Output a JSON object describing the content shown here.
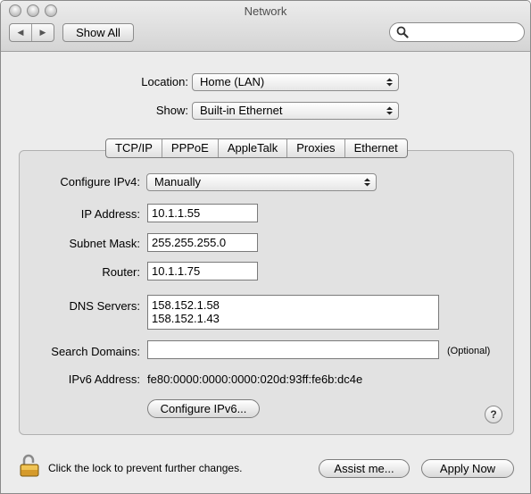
{
  "window": {
    "title": "Network"
  },
  "toolbar": {
    "back_glyph": "◀",
    "forward_glyph": "▶",
    "show_all_label": "Show All",
    "search_placeholder": ""
  },
  "location": {
    "label": "Location:",
    "value": "Home (LAN)"
  },
  "show": {
    "label": "Show:",
    "value": "Built-in Ethernet"
  },
  "tabs": [
    {
      "label": "TCP/IP",
      "selected": true
    },
    {
      "label": "PPPoE",
      "selected": false
    },
    {
      "label": "AppleTalk",
      "selected": false
    },
    {
      "label": "Proxies",
      "selected": false
    },
    {
      "label": "Ethernet",
      "selected": false
    }
  ],
  "tcpip": {
    "configure_label": "Configure IPv4:",
    "configure_value": "Manually",
    "ip_label": "IP Address:",
    "ip_value": "10.1.1.55",
    "subnet_label": "Subnet Mask:",
    "subnet_value": "255.255.255.0",
    "router_label": "Router:",
    "router_value": "10.1.1.75",
    "dns_label": "DNS Servers:",
    "dns_values": [
      "158.152.1.58",
      "158.152.1.43"
    ],
    "search_domains_label": "Search Domains:",
    "search_domains_value": "",
    "optional_label": "(Optional)",
    "ipv6_label": "IPv6 Address:",
    "ipv6_value": "fe80:0000:0000:0000:020d:93ff:fe6b:dc4e",
    "configure_ipv6_label": "Configure IPv6..."
  },
  "help_label": "?",
  "footer": {
    "lock_text": "Click the lock to prevent further changes.",
    "assist_label": "Assist me...",
    "apply_label": "Apply Now"
  }
}
